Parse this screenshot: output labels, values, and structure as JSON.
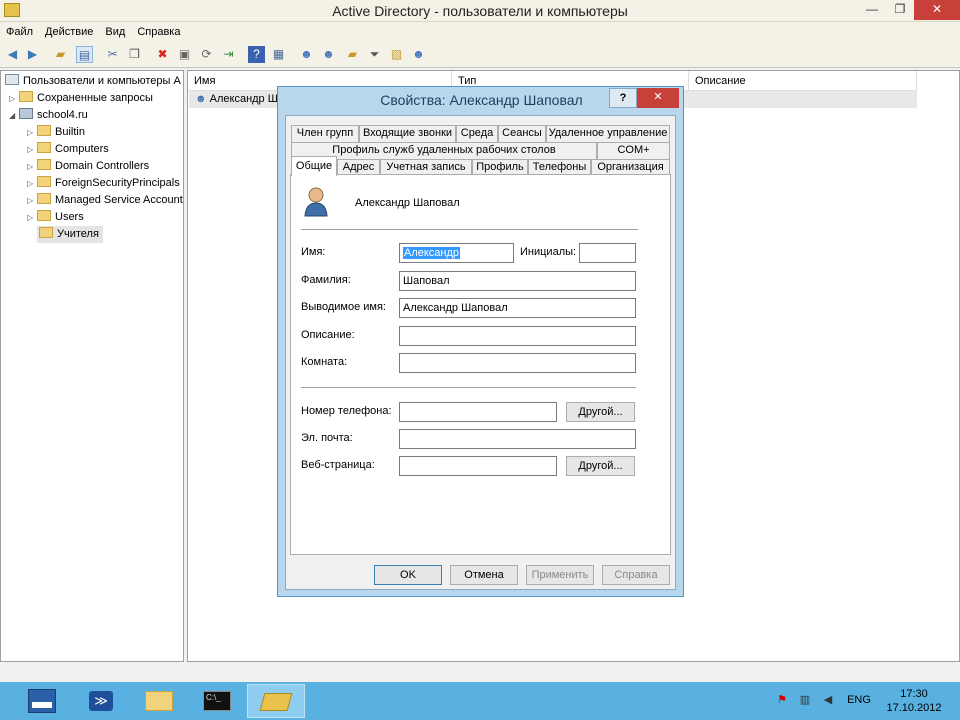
{
  "window": {
    "title": "Active Directory - пользователи и компьютеры",
    "min_glyph": "—",
    "max_glyph": "❐",
    "close_glyph": "✕"
  },
  "menu": [
    "Файл",
    "Действие",
    "Вид",
    "Справка"
  ],
  "toolbar_icons": [
    "back-icon",
    "forward-icon",
    "up-folder-icon",
    "properties-icon",
    "cut-icon",
    "copy-icon",
    "delete-icon",
    "rename-icon",
    "refresh-icon",
    "export-icon",
    "help-icon",
    "console-icon",
    "user-icon",
    "group-icon",
    "ou-icon",
    "filter-icon",
    "find-icon",
    "add-to-group-icon"
  ],
  "tree": {
    "root": "Пользователи и компьютеры Active Directory",
    "saved_queries": "Сохраненные запросы",
    "domain": "school4.ru",
    "children": [
      "Builtin",
      "Computers",
      "Domain Controllers",
      "ForeignSecurityPrincipals",
      "Managed Service Accounts",
      "Users",
      "Учителя"
    ]
  },
  "list": {
    "columns": [
      "Имя",
      "Тип",
      "Описание"
    ],
    "rows": [
      {
        "name": "Александр Шаповал"
      }
    ]
  },
  "dialog": {
    "title": "Свойства: Александр Шаповал",
    "help_glyph": "?",
    "close_glyph": "✕",
    "tabs_row1": [
      "Член групп",
      "Входящие звонки",
      "Среда",
      "Сеансы",
      "Удаленное управление"
    ],
    "tabs_row2": [
      "Профиль служб удаленных рабочих столов",
      "COM+"
    ],
    "tabs_row3": [
      "Общие",
      "Адрес",
      "Учетная запись",
      "Профиль",
      "Телефоны",
      "Организация"
    ],
    "active_tab": "Общие",
    "display_header": "Александр Шаповал",
    "fields": {
      "first_name_label": "Имя:",
      "first_name": "Александр",
      "initials_label": "Инициалы:",
      "initials": "",
      "last_name_label": "Фамилия:",
      "last_name": "Шаповал",
      "display_name_label": "Выводимое имя:",
      "display_name": "Александр Шаповал",
      "description_label": "Описание:",
      "description": "",
      "office_label": "Комната:",
      "office": "",
      "phone_label": "Номер телефона:",
      "phone": "",
      "email_label": "Эл. почта:",
      "email": "",
      "web_label": "Веб-страница:",
      "web": "",
      "other_button": "Другой..."
    },
    "buttons": {
      "ok": "OK",
      "cancel": "Отмена",
      "apply": "Применить",
      "help": "Справка"
    }
  },
  "taskbar": {
    "apps": [
      "server-manager-icon",
      "powershell-icon",
      "explorer-icon",
      "cmd-icon",
      "ad-users-computers-icon"
    ],
    "language": "ENG",
    "time": "17:30",
    "date": "17.10.2012"
  }
}
